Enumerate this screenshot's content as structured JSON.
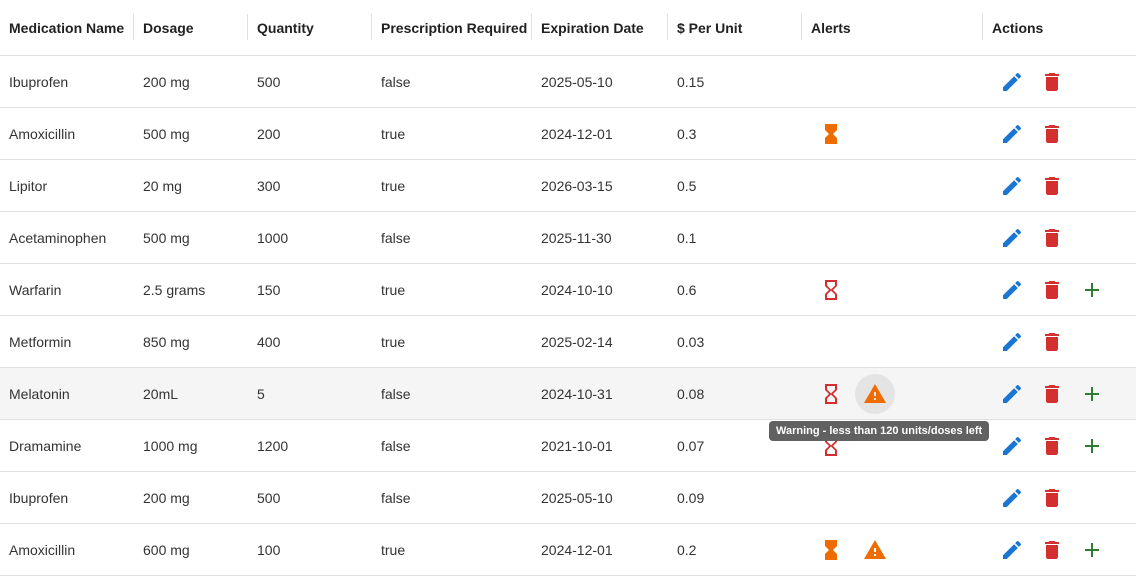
{
  "columns": [
    "Medication Name",
    "Dosage",
    "Quantity",
    "Prescription Required",
    "Expiration Date",
    "$ Per Unit",
    "Alerts",
    "Actions"
  ],
  "colors": {
    "edit": "#1976d2",
    "delete": "#d32f2f",
    "add": "#2e7d32",
    "expiring": "#ef6c00",
    "expired": "#d32f2f",
    "low_stock": "#ef6c00"
  },
  "icons": {
    "edit": "pencil-icon",
    "delete": "trash-icon",
    "add": "plus-icon",
    "hourglass": "hourglass-icon",
    "warning": "warning-triangle-icon"
  },
  "rows": [
    {
      "name": "Ibuprofen",
      "dosage": "200 mg",
      "quantity": "500",
      "prescription": "false",
      "expiration": "2025-05-10",
      "price": "0.15",
      "hourglass": "",
      "warning": false,
      "add": false
    },
    {
      "name": "Amoxicillin",
      "dosage": "500 mg",
      "quantity": "200",
      "prescription": "true",
      "expiration": "2024-12-01",
      "price": "0.3",
      "hourglass": "expiring",
      "warning": false,
      "add": false
    },
    {
      "name": "Lipitor",
      "dosage": "20 mg",
      "quantity": "300",
      "prescription": "true",
      "expiration": "2026-03-15",
      "price": "0.5",
      "hourglass": "",
      "warning": false,
      "add": false
    },
    {
      "name": "Acetaminophen",
      "dosage": "500 mg",
      "quantity": "1000",
      "prescription": "false",
      "expiration": "2025-11-30",
      "price": "0.1",
      "hourglass": "",
      "warning": false,
      "add": false
    },
    {
      "name": "Warfarin",
      "dosage": "2.5 grams",
      "quantity": "150",
      "prescription": "true",
      "expiration": "2024-10-10",
      "price": "0.6",
      "hourglass": "expired",
      "warning": false,
      "add": true
    },
    {
      "name": "Metformin",
      "dosage": "850 mg",
      "quantity": "400",
      "prescription": "true",
      "expiration": "2025-02-14",
      "price": "0.03",
      "hourglass": "",
      "warning": false,
      "add": false
    },
    {
      "name": "Melatonin",
      "dosage": "20mL",
      "quantity": "5",
      "prescription": "false",
      "expiration": "2024-10-31",
      "price": "0.08",
      "hourglass": "expired",
      "warning": true,
      "add": true
    },
    {
      "name": "Dramamine",
      "dosage": "1000 mg",
      "quantity": "1200",
      "prescription": "false",
      "expiration": "2021-10-01",
      "price": "0.07",
      "hourglass": "expired",
      "warning": false,
      "add": true
    },
    {
      "name": "Ibuprofen",
      "dosage": "200 mg",
      "quantity": "500",
      "prescription": "false",
      "expiration": "2025-05-10",
      "price": "0.09",
      "hourglass": "",
      "warning": false,
      "add": false
    },
    {
      "name": "Amoxicillin",
      "dosage": "600 mg",
      "quantity": "100",
      "prescription": "true",
      "expiration": "2024-12-01",
      "price": "0.2",
      "hourglass": "expiring",
      "warning": true,
      "add": true
    }
  ],
  "hovered_row": 6,
  "tooltip": "Warning - less than 120 units/doses left"
}
